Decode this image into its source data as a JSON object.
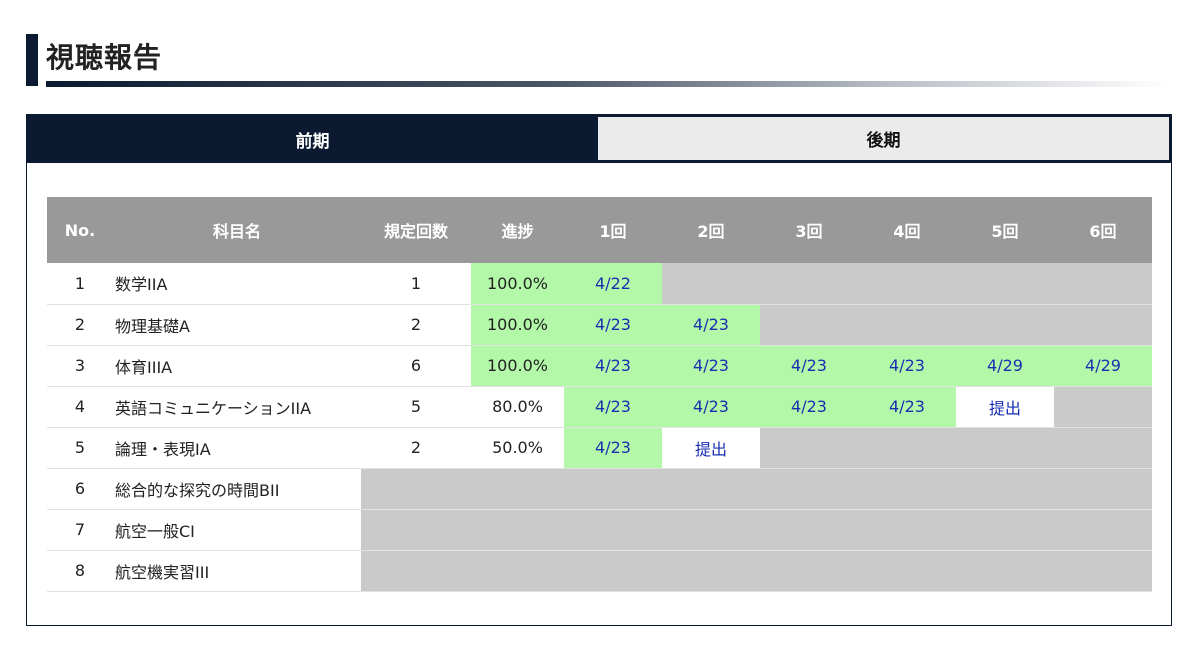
{
  "page": {
    "title": "視聴報告"
  },
  "tabs": [
    {
      "label": "前期",
      "active": true
    },
    {
      "label": "後期",
      "active": false
    }
  ],
  "table": {
    "headers": [
      "No.",
      "科目名",
      "規定回数",
      "進捗",
      "1回",
      "2回",
      "3回",
      "4回",
      "5回",
      "6回"
    ],
    "rows": [
      {
        "no": "1",
        "subject": "数学IIA",
        "required": "1",
        "progress": "100.0%",
        "sessions": [
          "4/22",
          "",
          "",
          "",
          "",
          ""
        ]
      },
      {
        "no": "2",
        "subject": "物理基礎A",
        "required": "2",
        "progress": "100.0%",
        "sessions": [
          "4/23",
          "4/23",
          "",
          "",
          "",
          ""
        ]
      },
      {
        "no": "3",
        "subject": "体育IIIA",
        "required": "6",
        "progress": "100.0%",
        "sessions": [
          "4/23",
          "4/23",
          "4/23",
          "4/23",
          "4/29",
          "4/29"
        ]
      },
      {
        "no": "4",
        "subject": "英語コミュニケーションIIA",
        "required": "5",
        "progress": "80.0%",
        "sessions": [
          "4/23",
          "4/23",
          "4/23",
          "4/23",
          "提出",
          ""
        ]
      },
      {
        "no": "5",
        "subject": "論理・表現IA",
        "required": "2",
        "progress": "50.0%",
        "sessions": [
          "4/23",
          "提出",
          "",
          "",
          "",
          ""
        ]
      },
      {
        "no": "6",
        "subject": "総合的な探究の時間BII",
        "required": "",
        "progress": "",
        "sessions": []
      },
      {
        "no": "7",
        "subject": "航空一般CI",
        "required": "",
        "progress": "",
        "sessions": []
      },
      {
        "no": "8",
        "subject": "航空機実習III",
        "required": "",
        "progress": "",
        "sessions": []
      }
    ]
  },
  "colors": {
    "navy": "#0b1a30",
    "complete": "#b3f7a8",
    "unavailable": "#cacaca",
    "header": "#999999",
    "date_text": "#1a2fb0"
  }
}
